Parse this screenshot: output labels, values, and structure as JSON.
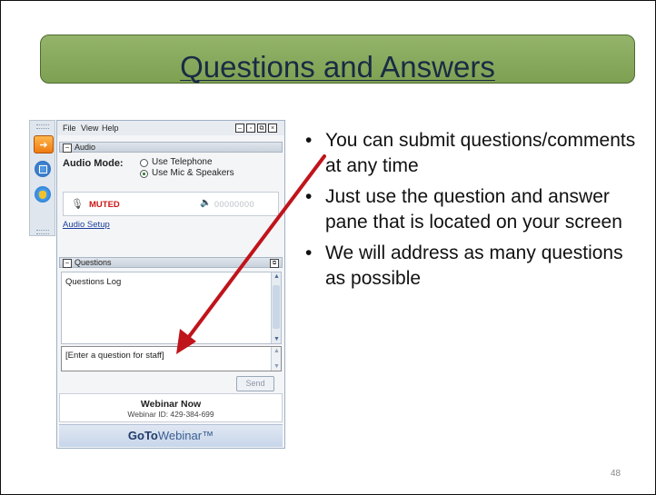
{
  "slide": {
    "title": "Questions and Answers",
    "bullets": [
      "You can submit questions/comments at any time",
      "Just use the question and answer pane that is located on your screen",
      "We will address as many questions as possible"
    ],
    "page_number": "48"
  },
  "gtw": {
    "menu": {
      "file": "File",
      "view": "View",
      "help": "Help"
    },
    "audio": {
      "section_label": "Audio",
      "mode_label": "Audio Mode:",
      "option_telephone": "Use Telephone",
      "option_mic": "Use Mic & Speakers",
      "selected": "Use Mic & Speakers",
      "status": "MUTED",
      "level_text": "00000000",
      "setup_link": "Audio Setup"
    },
    "questions": {
      "section_label": "Questions",
      "log_label": "Questions Log",
      "input_placeholder": "[Enter a question for staff]",
      "send_label": "Send"
    },
    "webinar": {
      "name": "Webinar Now",
      "id_text": "Webinar ID: 429-384-699"
    },
    "brand": {
      "bold": "GoTo",
      "rest": "Webinar™"
    }
  },
  "colors": {
    "title_bar": "#8bad60",
    "arrow": "#c0141b",
    "muted": "#c81818",
    "link": "#1b3f9c"
  }
}
